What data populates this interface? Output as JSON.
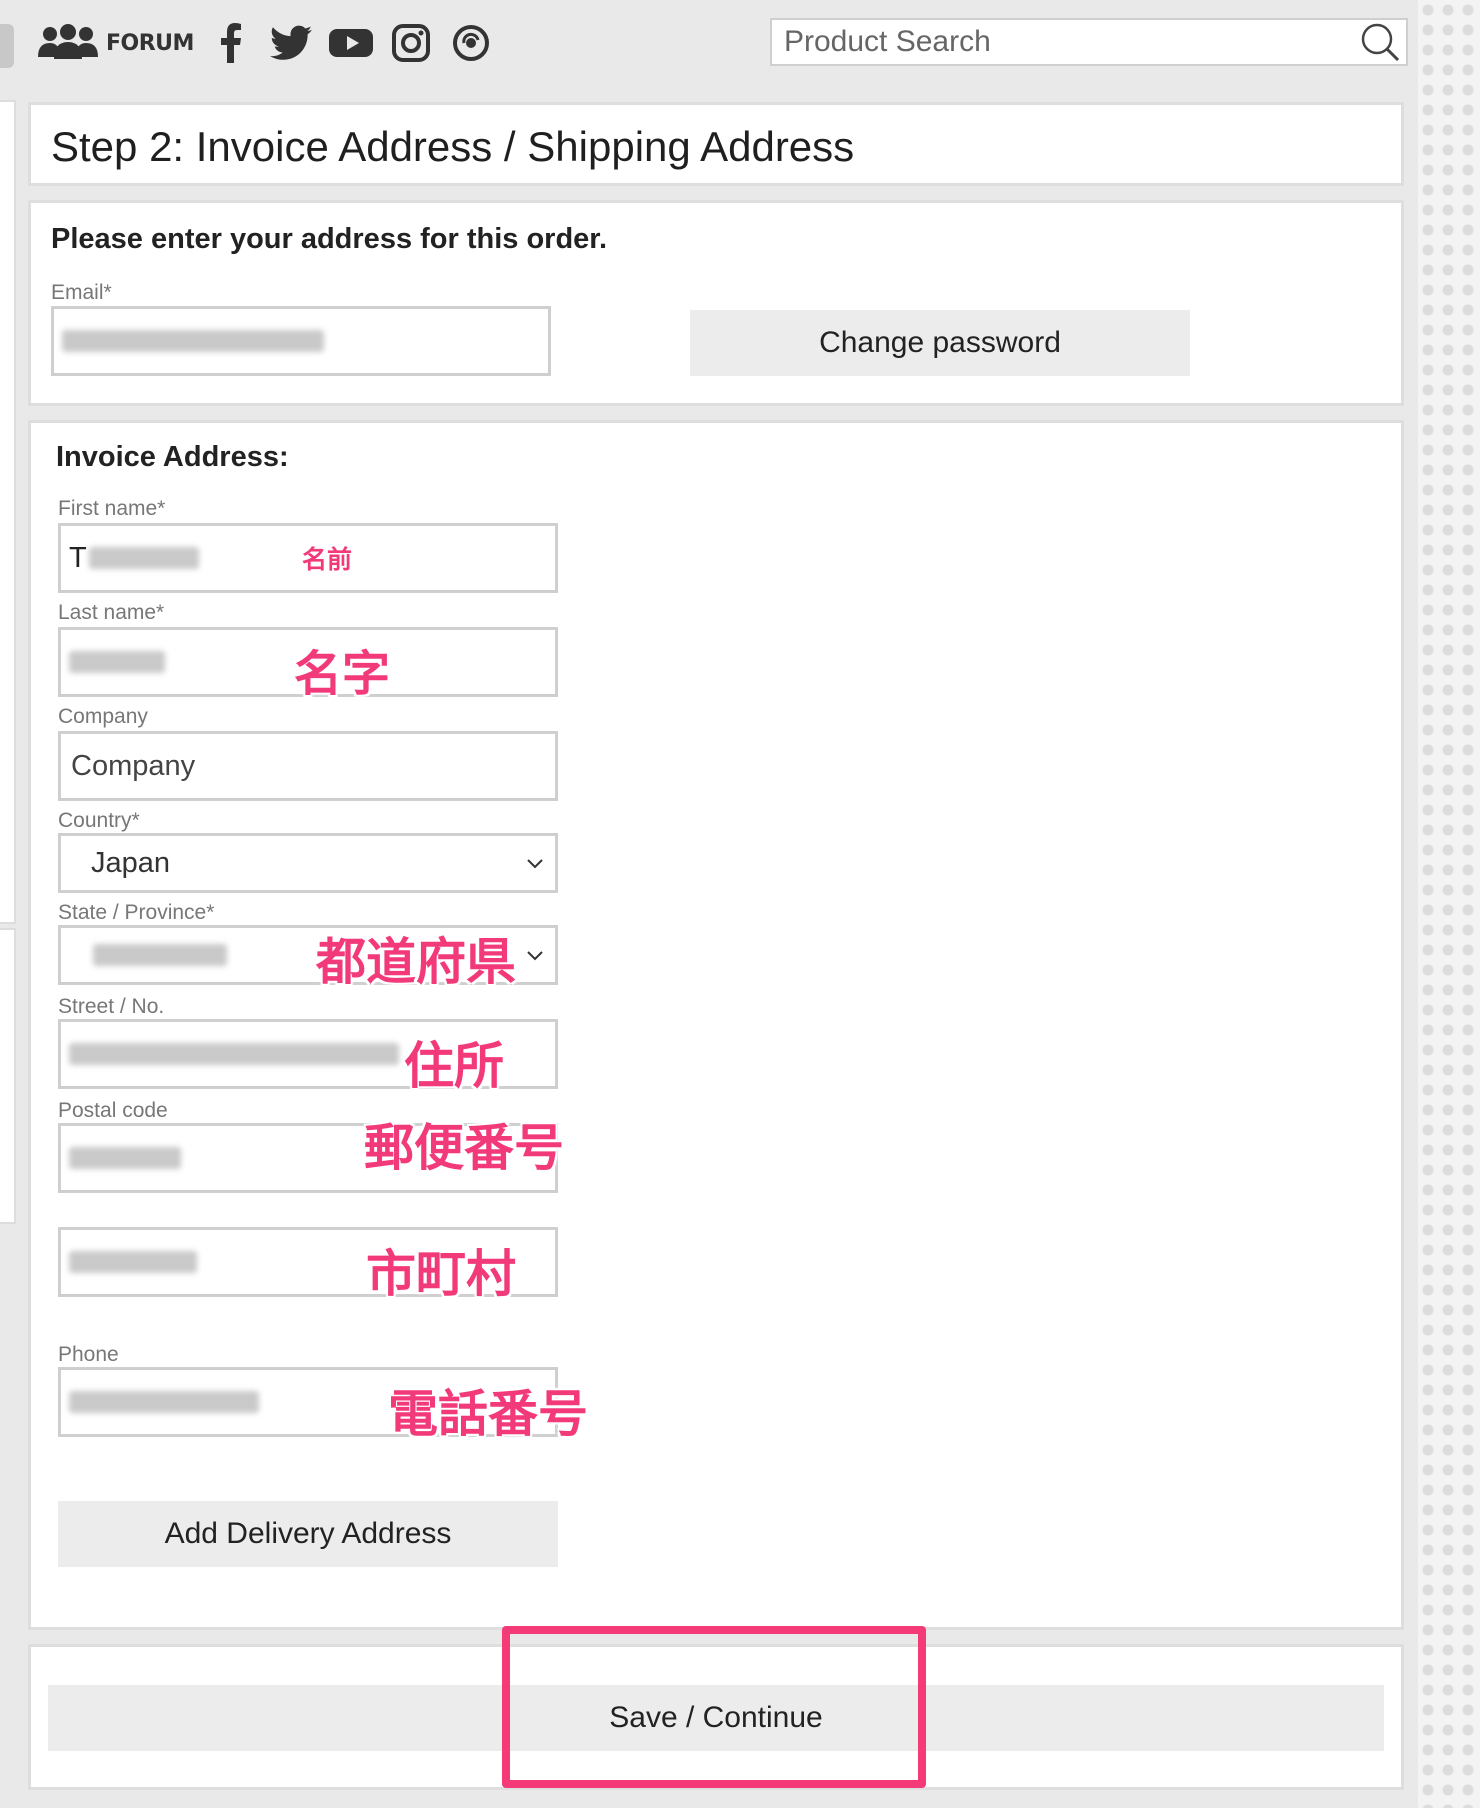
{
  "topbar": {
    "forum_label": "FORUM",
    "icons": [
      "people-icon",
      "facebook-icon",
      "twitter-icon",
      "youtube-icon",
      "instagram-icon",
      "circle-link-icon"
    ],
    "search_placeholder": "Product Search"
  },
  "page": {
    "step_title": "Step 2: Invoice Address / Shipping Address",
    "intro": "Please enter your address for this order.",
    "email_label": "Email*",
    "change_password": "Change password"
  },
  "invoice": {
    "title": "Invoice Address:",
    "first_name_label": "First name*",
    "last_name_label": "Last name*",
    "company_label": "Company",
    "company_placeholder": "Company",
    "country_label": "Country*",
    "country_value": "Japan",
    "state_label": "State / Province*",
    "street_label": "Street / No.",
    "postal_label": "Postal code",
    "phone_label": "Phone",
    "add_delivery": "Add Delivery Address"
  },
  "annotations": {
    "first_name": "名前",
    "last_name": "名字",
    "state": "都道府県",
    "street": "住所",
    "postal": "郵便番号",
    "city": "市町村",
    "phone": "電話番号"
  },
  "footer": {
    "save_continue": "Save / Continue"
  },
  "colors": {
    "annotation": "#f23a7a",
    "highlight_border": "#f53a78",
    "button_bg": "#ececec",
    "page_bg": "#e9e9e9"
  }
}
